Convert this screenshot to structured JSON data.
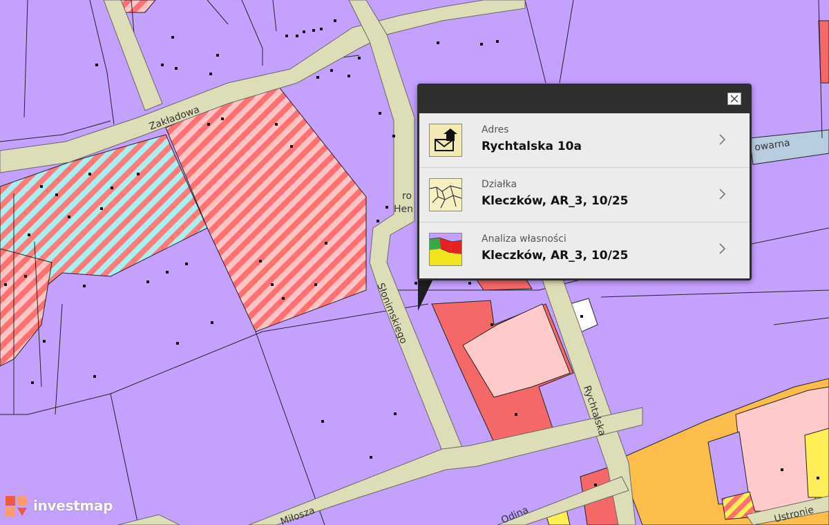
{
  "map": {
    "streets": {
      "zakladowa": "Zakładowa",
      "slonimskiego": "Słonimskiego",
      "rychtalska": "Rychtalska",
      "milosza": "Miłosza",
      "odina": "Odina",
      "ustronie": "Ustronie",
      "towarna": "owarna",
      "partial_1": "ro",
      "partial_2": "Hen"
    }
  },
  "popup": {
    "rows": [
      {
        "label": "Adres",
        "value": "Rychtalska 10a",
        "icon": "address-envelope-icon"
      },
      {
        "label": "Działka",
        "value": "Kleczków, AR_3, 10/25",
        "icon": "parcel-map-icon"
      },
      {
        "label": "Analiza własności",
        "value": "Kleczków, AR_3, 10/25",
        "icon": "ownership-map-icon"
      }
    ],
    "close_icon": "close-icon"
  },
  "brand": {
    "name": "investmap",
    "logo_colors": [
      "#f05a3c",
      "#ff9a6a"
    ]
  },
  "colors": {
    "residential": "#c4a0ff",
    "road": "#ddddb8",
    "commercial_red": "#f56868",
    "commercial_pink": "#ffcaca",
    "hatch_red": "#ff7070",
    "hatch_cyan": "#a8f0f0",
    "industrial_orange": "#fdbd4a",
    "river": "#b9cde0"
  }
}
